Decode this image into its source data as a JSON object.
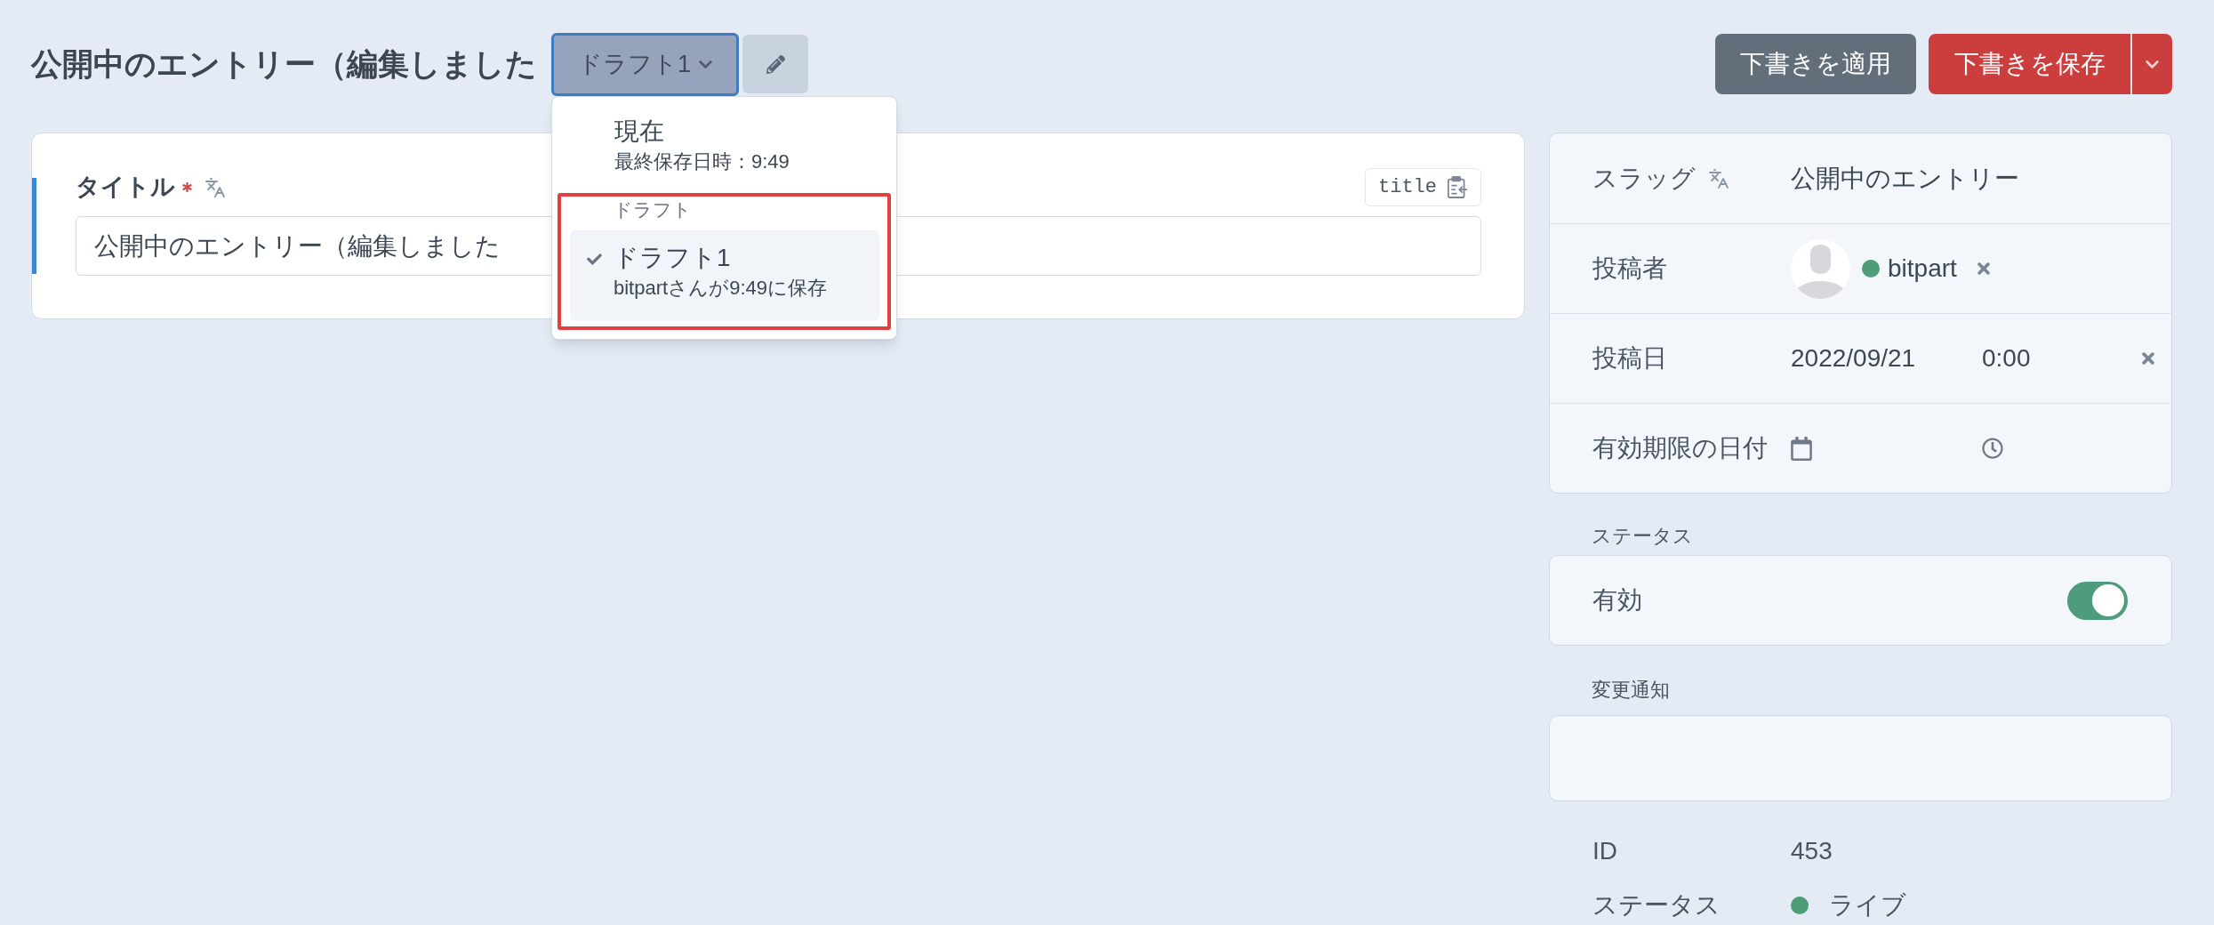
{
  "header": {
    "title": "公開中のエントリー（編集しました",
    "draft_button": {
      "label": "ドラフト1",
      "expanded": true
    },
    "actions": [
      {
        "kind": "secondary",
        "label": "下書きを適用"
      },
      {
        "kind": "primary",
        "label": "下書きを保存",
        "split": true
      }
    ]
  },
  "draft_menu": {
    "current": {
      "title": "現在",
      "subtitle": "最終保存日時：9:49",
      "selected": false
    },
    "drafts": {
      "heading": "ドラフト",
      "highlighted": true,
      "items": [
        {
          "title": "ドラフト1",
          "subtitle": "bitpartさんが9:49に保存",
          "selected": true
        }
      ]
    }
  },
  "title_field": {
    "label": "タイトル",
    "required": true,
    "translatable": true,
    "handle": "title",
    "value": "公開中のエントリー（編集しました"
  },
  "sidebar": {
    "fields": [
      {
        "kind": "text",
        "label": "スラッグ",
        "translatable": true,
        "value": "公開中のエントリー"
      },
      {
        "kind": "author",
        "label": "投稿者",
        "value": "bitpart",
        "color": "#4c9d78",
        "clearable": true
      },
      {
        "kind": "datetime",
        "label": "投稿日",
        "date": "2022/09/21",
        "time": "0:00",
        "clearable": true
      },
      {
        "kind": "datetime",
        "label": "有効期限の日付"
      }
    ],
    "status": {
      "label": "ステータス",
      "toggle_label": "有効",
      "on": true
    },
    "notification": {
      "label": "変更通知"
    },
    "meta": [
      {
        "label": "ID",
        "value": "453"
      },
      {
        "label": "ステータス",
        "value": "ライブ",
        "color": "#4c9d78"
      }
    ]
  }
}
